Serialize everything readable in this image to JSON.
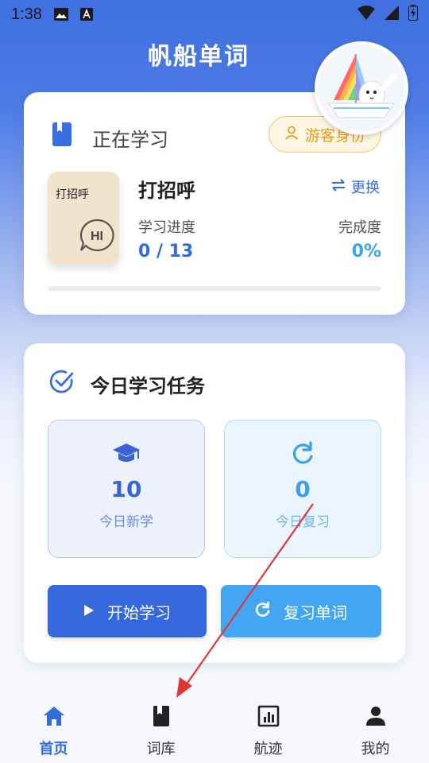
{
  "status_bar": {
    "time": "1:38",
    "icons": [
      "image-icon",
      "a-icon",
      "wifi-icon",
      "signal-icon",
      "battery-icon"
    ]
  },
  "app": {
    "title": "帆船单词"
  },
  "current_learning": {
    "heading": "正在学习",
    "guest_label": "游客身份",
    "book_cover_text": "打招呼",
    "book_cover_badge": "HI",
    "wordbook_name": "打招呼",
    "change_label": "更换",
    "progress_label": "学习进度",
    "progress_value": "0 / 13",
    "completion_label": "完成度",
    "completion_value": "0%",
    "progress_fraction": 0
  },
  "daily_tasks": {
    "heading": "今日学习任务",
    "new": {
      "number": "10",
      "caption": "今日新学"
    },
    "review": {
      "number": "0",
      "caption": "今日复习"
    },
    "start_button": "开始学习",
    "review_button": "复习单词"
  },
  "tab_bar": {
    "items": [
      {
        "label": "首页",
        "icon": "home-icon",
        "active": true
      },
      {
        "label": "词库",
        "icon": "book-icon",
        "active": false
      },
      {
        "label": "航迹",
        "icon": "chart-icon",
        "active": false
      },
      {
        "label": "我的",
        "icon": "person-icon",
        "active": false
      }
    ]
  },
  "colors": {
    "primary": "#3568dc",
    "secondary": "#43a6f2",
    "accent_orange": "#e79a1a",
    "annotation": "#e0363a"
  }
}
